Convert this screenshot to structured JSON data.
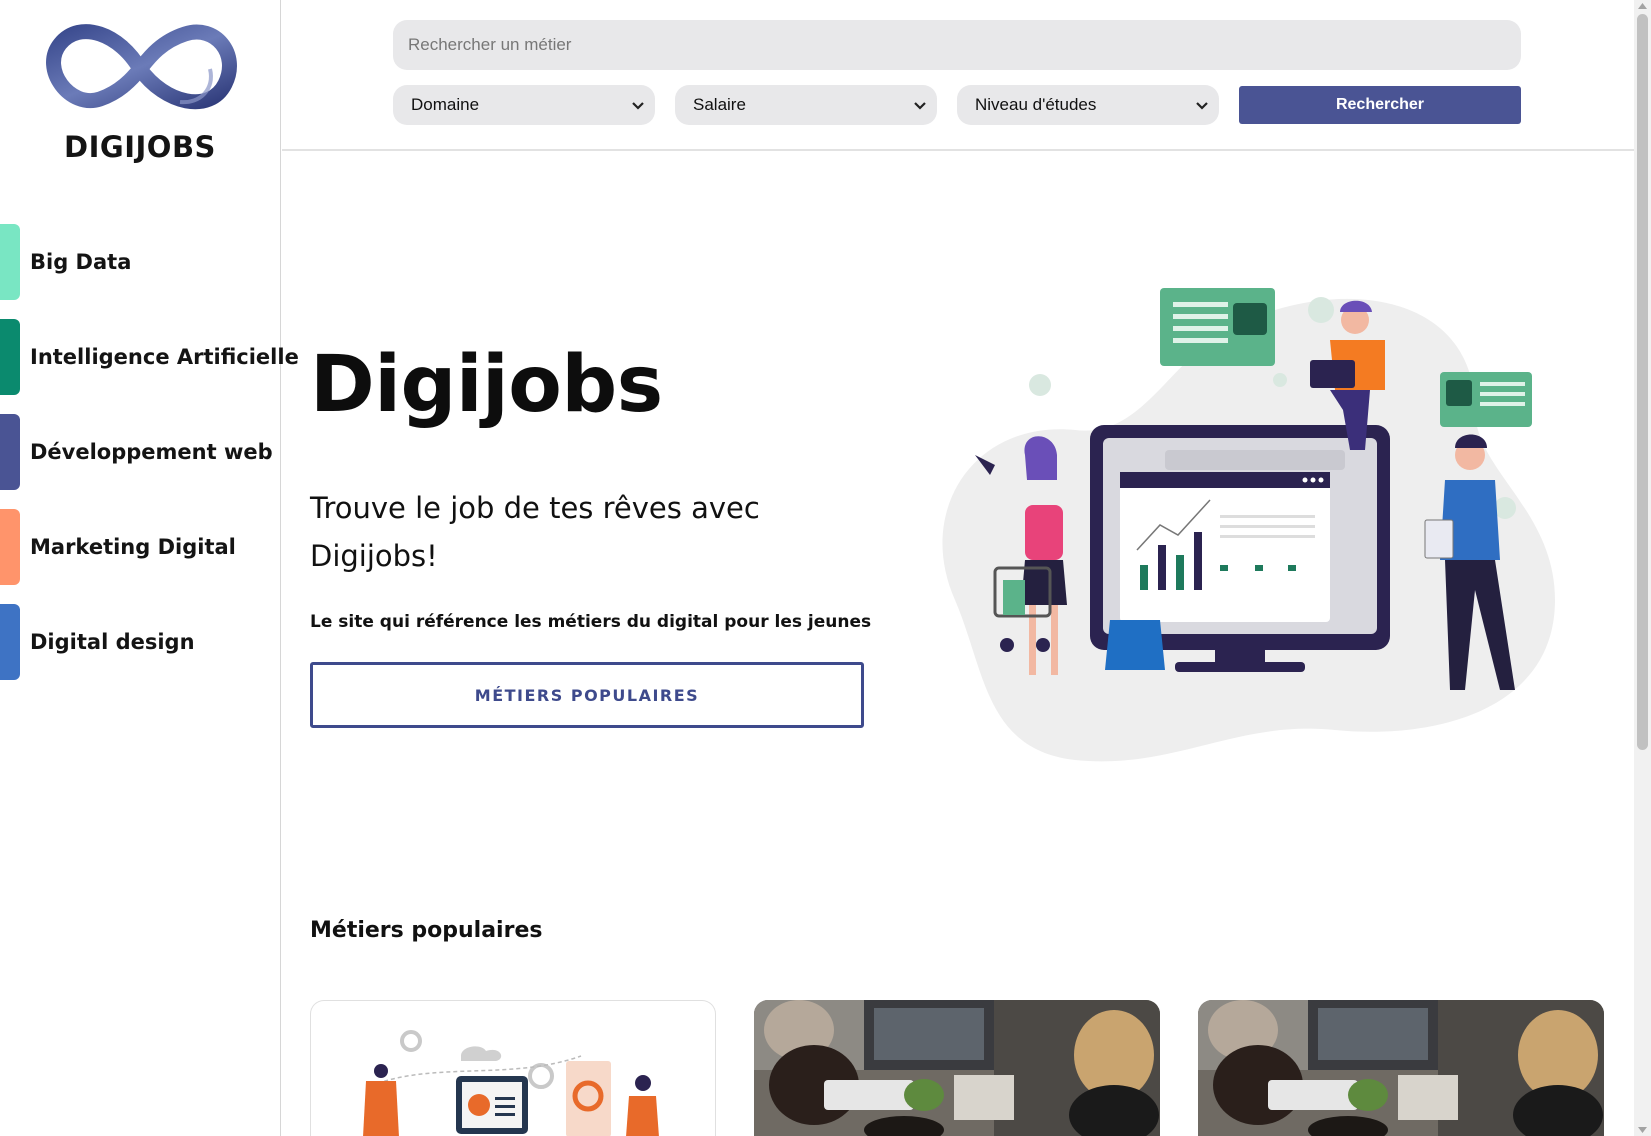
{
  "brand": {
    "name": "DIGIJOBS"
  },
  "sidebar": {
    "items": [
      {
        "label": "Big Data",
        "color": "#79e6c3"
      },
      {
        "label": "Intelligence Artificielle",
        "color": "#0b8a6e"
      },
      {
        "label": "Développement web",
        "color": "#4a5494"
      },
      {
        "label": "Marketing Digital",
        "color": "#ff946b"
      },
      {
        "label": "Digital design",
        "color": "#3e73c4"
      }
    ]
  },
  "search": {
    "placeholder": "Rechercher un métier",
    "filters": {
      "domain": "Domaine",
      "salary": "Salaire",
      "education": "Niveau d'études"
    },
    "button_label": "Rechercher"
  },
  "hero": {
    "title": "Digijobs",
    "subtitle": "Trouve le job de tes rêves avec Digijobs!",
    "description": "Le site qui référence les métiers du digital pour les jeunes",
    "button_label": "MÉTIERS POPULAIRES"
  },
  "popular": {
    "title": "Métiers populaires"
  },
  "colors": {
    "accent": "#4a5494",
    "hero_button_border": "#3e4a8c"
  }
}
